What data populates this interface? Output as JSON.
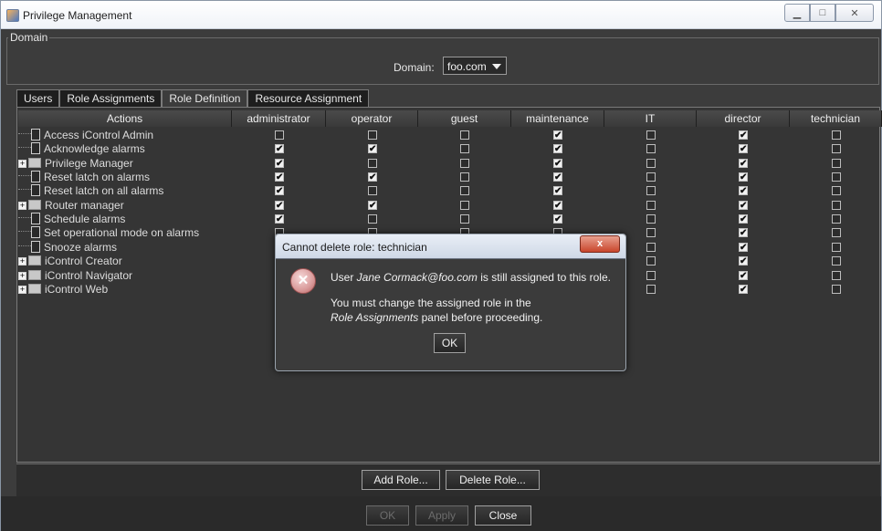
{
  "window": {
    "title": "Privilege Management",
    "controls": [
      "minimize",
      "maximize",
      "close"
    ]
  },
  "domain": {
    "legend": "Domain",
    "label": "Domain:",
    "value": "foo.com"
  },
  "tabs": [
    "Users",
    "Role Assignments",
    "Role Definition",
    "Resource Assignment"
  ],
  "active_tab": "Role Definition",
  "table": {
    "columns": [
      "Actions",
      "administrator",
      "operator",
      "guest",
      "maintenance",
      "IT",
      "director",
      "technician"
    ],
    "rows": [
      {
        "label": "Access iControl Admin",
        "type": "leaf",
        "checks": [
          0,
          0,
          0,
          1,
          0,
          1,
          0
        ]
      },
      {
        "label": "Acknowledge alarms",
        "type": "leaf",
        "checks": [
          1,
          1,
          0,
          1,
          0,
          1,
          0
        ]
      },
      {
        "label": "Privilege Manager",
        "type": "folder",
        "checks": [
          1,
          0,
          0,
          1,
          0,
          1,
          0
        ]
      },
      {
        "label": "Reset latch on alarms",
        "type": "leaf",
        "checks": [
          1,
          1,
          0,
          1,
          0,
          1,
          0
        ]
      },
      {
        "label": "Reset latch on all alarms",
        "type": "leaf",
        "checks": [
          1,
          0,
          0,
          1,
          0,
          1,
          0
        ]
      },
      {
        "label": "Router manager",
        "type": "folder",
        "checks": [
          1,
          1,
          0,
          1,
          0,
          1,
          0
        ]
      },
      {
        "label": "Schedule alarms",
        "type": "leaf",
        "checks": [
          1,
          0,
          0,
          1,
          0,
          1,
          0
        ]
      },
      {
        "label": "Set operational mode on alarms",
        "type": "leaf",
        "checks": [
          0,
          0,
          0,
          0,
          0,
          1,
          0
        ]
      },
      {
        "label": "Snooze alarms",
        "type": "leaf",
        "checks": [
          0,
          0,
          0,
          0,
          0,
          1,
          0
        ]
      },
      {
        "label": "iControl Creator",
        "type": "folder",
        "checks": [
          0,
          0,
          0,
          0,
          0,
          1,
          0
        ]
      },
      {
        "label": "iControl Navigator",
        "type": "folder",
        "checks": [
          0,
          0,
          0,
          0,
          0,
          1,
          0
        ]
      },
      {
        "label": "iControl Web",
        "type": "folder",
        "checks": [
          0,
          0,
          0,
          0,
          0,
          1,
          0
        ]
      }
    ]
  },
  "buttons": {
    "add_role": "Add Role...",
    "delete_role": "Delete Role...",
    "ok": "OK",
    "apply": "Apply",
    "close": "Close"
  },
  "dialog": {
    "title": "Cannot delete role: technician",
    "close_glyph": "x",
    "line1_pre": "User ",
    "line1_user": "Jane Cormack@foo.com",
    "line1_post": " is still assigned to this role.",
    "line2": "You must change the assigned role in the",
    "line3_panel": "Role Assignments",
    "line3_post": " panel before proceeding.",
    "ok": "OK"
  }
}
